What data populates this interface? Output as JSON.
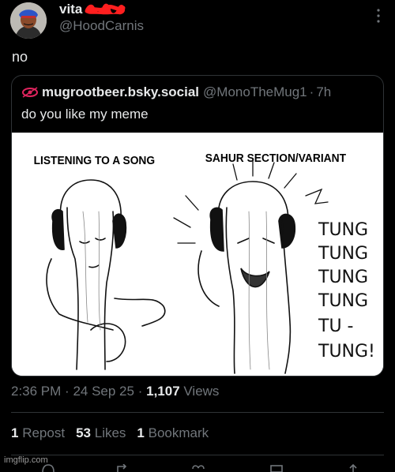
{
  "author": {
    "display_name": "vita",
    "handle": "@HoodCarnis"
  },
  "tweet": {
    "text": "no"
  },
  "quote": {
    "name": "mugrootbeer.bsky.social",
    "handle": "@MonoTheMug1",
    "separator": "·",
    "time": "7h",
    "text": "do you like my meme",
    "meme": {
      "left_caption": "LISTENING TO A SONG",
      "right_caption": "SAHUR SECTION/VARIANT",
      "chant": [
        "TUNG",
        "TUNG",
        "TUNG",
        "TUNG",
        "TU -",
        "TUNG!"
      ]
    }
  },
  "meta": {
    "time": "2:36 PM",
    "sep1": "·",
    "date": "24 Sep 25",
    "sep2": "·",
    "views_count": "1,107",
    "views_label": "Views"
  },
  "stats": {
    "reposts_count": "1",
    "reposts_label": "Repost",
    "likes_count": "53",
    "likes_label": "Likes",
    "bookmarks_count": "1",
    "bookmarks_label": "Bookmark"
  },
  "watermark": "imgflip.com",
  "colors": {
    "background": "#000000",
    "text": "#e7e9ea",
    "secondary": "#71767b",
    "border": "#2f3336",
    "redaction": "#ff1f1f",
    "bsky_icon": "#e0245e"
  },
  "icons": [
    "more-icon",
    "bluesky-eye-icon",
    "reply-icon",
    "repost-icon",
    "like-icon",
    "views-icon",
    "share-icon"
  ]
}
